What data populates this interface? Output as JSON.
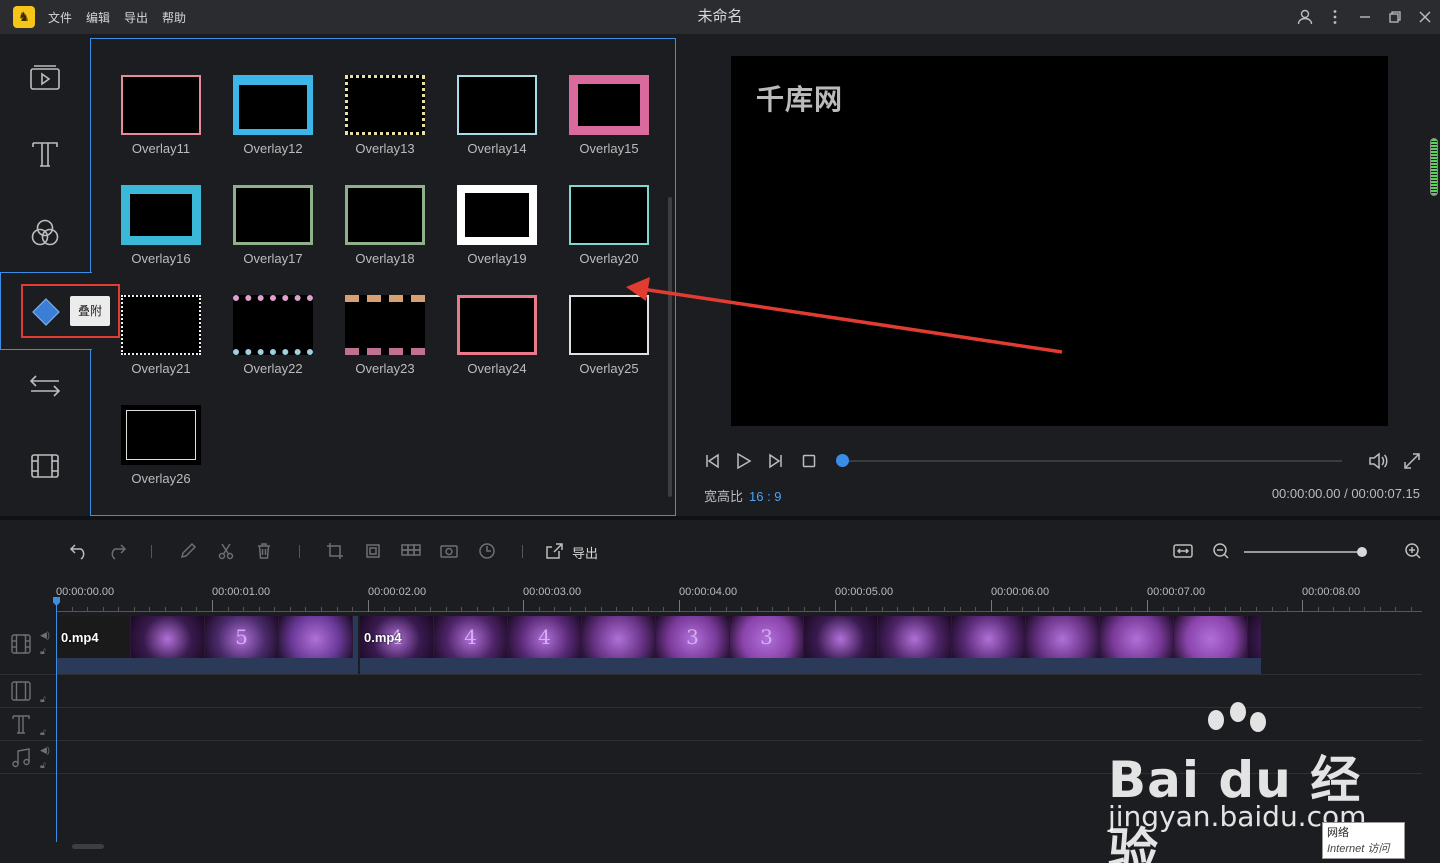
{
  "titlebar": {
    "app_logo": "app-logo",
    "menu": [
      "文件",
      "编辑",
      "导出",
      "帮助"
    ],
    "title": "未命名"
  },
  "left_toolbar": {
    "tools": [
      "media",
      "text",
      "filters",
      "overlays",
      "transitions",
      "elements"
    ],
    "active_tool": "overlays",
    "tooltip": "叠附"
  },
  "overlays": [
    "Overlay11",
    "Overlay12",
    "Overlay13",
    "Overlay14",
    "Overlay15",
    "Overlay16",
    "Overlay17",
    "Overlay18",
    "Overlay19",
    "Overlay20",
    "Overlay21",
    "Overlay22",
    "Overlay23",
    "Overlay24",
    "Overlay25",
    "Overlay26"
  ],
  "preview": {
    "watermark": "千库网",
    "aspect_label": "宽高比",
    "aspect_value": "16 : 9",
    "time": "00:00:00.00 / 00:00:07.15",
    "progress": 0
  },
  "timeline_toolbar": {
    "export_label": "导出"
  },
  "ruler": {
    "ticks": [
      "00:00:00.00",
      "00:00:01.00",
      "00:00:02.00",
      "00:00:03.00",
      "00:00:04.00",
      "00:00:05.00",
      "00:00:06.00",
      "00:00:07.00",
      "00:00:08.00"
    ]
  },
  "clips": [
    {
      "name": "0.mp4",
      "marks": [
        "",
        "",
        "5",
        ""
      ]
    },
    {
      "name": "0.mp4",
      "marks": [
        "4",
        "4",
        "4",
        "",
        "3",
        "3",
        "",
        "",
        "",
        "",
        "",
        "",
        "",
        ""
      ]
    }
  ],
  "watermark": {
    "brand": "Bai du 经验",
    "url": "jingyan.baidu.com"
  },
  "net_popup": {
    "line1": "网络",
    "line2": "Internet 访问"
  },
  "colors": {
    "accent": "#3a8ee6",
    "highlight_box": "#e03c31",
    "arrow": "#e03c31"
  }
}
